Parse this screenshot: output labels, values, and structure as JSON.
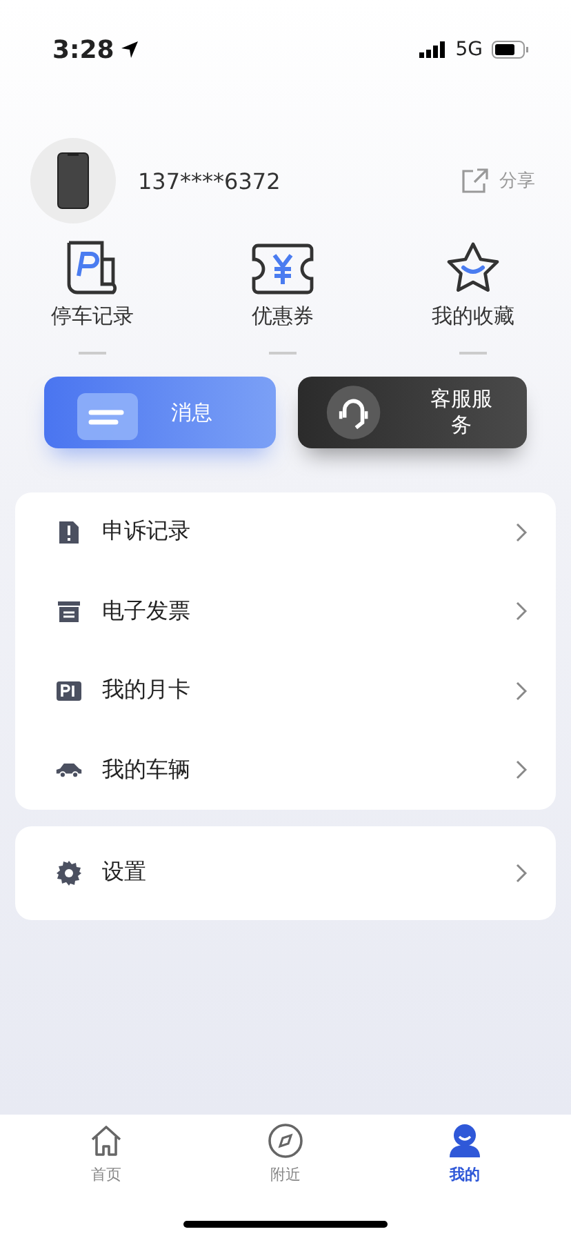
{
  "status_bar": {
    "time": "3:28",
    "network": "5G"
  },
  "profile": {
    "phone": "137****6372",
    "share": "分享"
  },
  "quick_links": [
    {
      "label": "停车记录"
    },
    {
      "label": "优惠券"
    },
    {
      "label": "我的收藏"
    }
  ],
  "action_buttons": [
    {
      "label": "消息",
      "kind": "message"
    },
    {
      "label": "客服服务",
      "kind": "service"
    }
  ],
  "menu": [
    {
      "label": "申诉记录"
    },
    {
      "label": "电子发票"
    },
    {
      "label": "我的月卡"
    },
    {
      "label": "我的车辆"
    }
  ],
  "settings_menu": [
    {
      "label": "设置"
    }
  ],
  "tab_bar": [
    {
      "label": "首页",
      "selected": false
    },
    {
      "label": "附近",
      "selected": false
    },
    {
      "label": "我的",
      "selected": true
    }
  ]
}
